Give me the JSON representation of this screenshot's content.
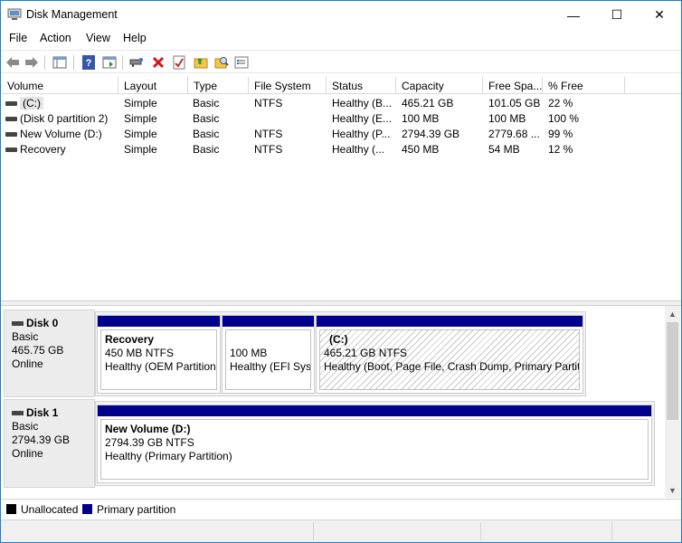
{
  "window": {
    "title": "Disk Management",
    "minimize_glyph": "—",
    "maximize_glyph": "☐",
    "close_glyph": "✕"
  },
  "menu": [
    "File",
    "Action",
    "View",
    "Help"
  ],
  "toolbar": {
    "icons": [
      "back-arrow-icon",
      "forward-arrow-icon",
      "show-hide-console-tree-icon",
      "help-icon",
      "show-action-pane-icon",
      "connect-drive-icon",
      "delete-icon",
      "properties-icon",
      "open-folder-icon",
      "explore-icon",
      "settings-icon"
    ]
  },
  "columns": [
    "Volume",
    "Layout",
    "Type",
    "File System",
    "Status",
    "Capacity",
    "Free Spa...",
    "% Free"
  ],
  "volumes": [
    {
      "name": "(C:)",
      "layout": "Simple",
      "type": "Basic",
      "fs": "NTFS",
      "status": "Healthy (B...",
      "capacity": "465.21 GB",
      "free": "101.05 GB",
      "pct": "22 %"
    },
    {
      "name": "(Disk 0 partition 2)",
      "layout": "Simple",
      "type": "Basic",
      "fs": "",
      "status": "Healthy (E...",
      "capacity": "100 MB",
      "free": "100 MB",
      "pct": "100 %"
    },
    {
      "name": "New Volume (D:)",
      "layout": "Simple",
      "type": "Basic",
      "fs": "NTFS",
      "status": "Healthy (P...",
      "capacity": "2794.39 GB",
      "free": "2779.68 ...",
      "pct": "99 %"
    },
    {
      "name": "Recovery",
      "layout": "Simple",
      "type": "Basic",
      "fs": "NTFS",
      "status": "Healthy (...",
      "capacity": "450 MB",
      "free": "54 MB",
      "pct": "12 %"
    }
  ],
  "disks": [
    {
      "name": "Disk 0",
      "type": "Basic",
      "size": "465.75 GB",
      "state": "Online",
      "partitions": [
        {
          "title": "Recovery",
          "size": "450 MB NTFS",
          "status": "Healthy (OEM Partition"
        },
        {
          "title": "",
          "size": "100 MB",
          "status": "Healthy (EFI Syst"
        },
        {
          "title": "(C:)",
          "size": "465.21 GB NTFS",
          "status": "Healthy (Boot, Page File, Crash Dump, Primary Partitio"
        }
      ]
    },
    {
      "name": "Disk 1",
      "type": "Basic",
      "size": "2794.39 GB",
      "state": "Online",
      "partitions": [
        {
          "title": "New Volume  (D:)",
          "size": "2794.39 GB NTFS",
          "status": "Healthy (Primary Partition)"
        }
      ]
    }
  ],
  "legend": [
    {
      "label": "Unallocated",
      "color": "#000000"
    },
    {
      "label": "Primary partition",
      "color": "#00008b"
    }
  ],
  "colors": {
    "primary_partition": "#00008b",
    "window_border": "#1a7fd4"
  }
}
